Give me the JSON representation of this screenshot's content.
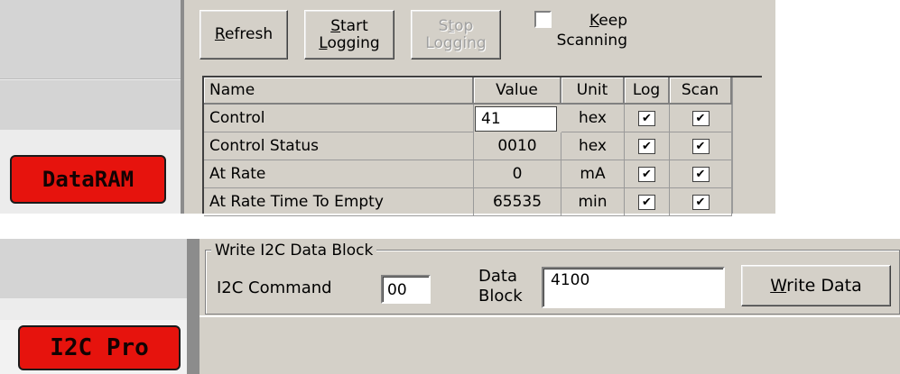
{
  "top_panel": {
    "logo": "DataRAM",
    "buttons": {
      "refresh": {
        "pre": "",
        "mnemonic": "R",
        "post": "efresh"
      },
      "start_line1_mnemonic": "S",
      "start_line1_rest": "tart",
      "start_line2_mnemonic": "L",
      "start_line2_rest": "ogging",
      "stop_line1_pre": "S",
      "stop_line1_mnemonic": "t",
      "stop_line1_rest": "op",
      "stop_line2": "Logging"
    },
    "keep_scanning": {
      "mnemonic": "K",
      "rest": "eep",
      "line2": "Scanning",
      "checked": false
    },
    "table": {
      "headers": [
        "Name",
        "Value",
        "Unit",
        "Log",
        "Scan"
      ],
      "rows": [
        {
          "name": "Control",
          "value": "41",
          "unit": "hex",
          "log": true,
          "scan": true
        },
        {
          "name": "Control Status",
          "value": "0010",
          "unit": "hex",
          "log": true,
          "scan": true
        },
        {
          "name": "At Rate",
          "value": "0",
          "unit": "mA",
          "log": true,
          "scan": true
        },
        {
          "name": "At Rate Time To Empty",
          "value": "65535",
          "unit": "min",
          "log": true,
          "scan": true
        }
      ]
    }
  },
  "bottom_panel": {
    "logo": "I2C Pro",
    "group_title": "Write I2C Data Block",
    "i2c_command_label": "I2C Command",
    "i2c_command_value": "00",
    "data_block_label_1": "Data",
    "data_block_label_2": "Block",
    "data_block_value": "4100",
    "write_button": {
      "mnemonic": "W",
      "rest": "rite Data"
    }
  },
  "colors": {
    "logo_red": "#e6130d",
    "button_face": "#d4d0c8",
    "sidebar": "#d4d4d4"
  }
}
